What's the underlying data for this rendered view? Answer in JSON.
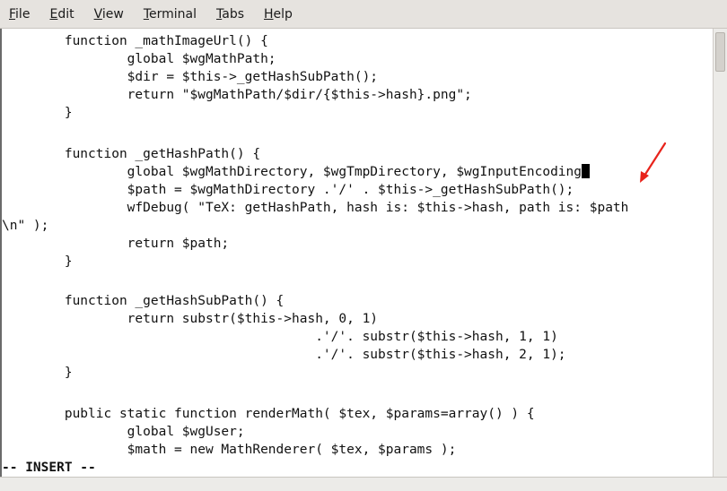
{
  "menu": [
    {
      "mnemonic": "F",
      "rest": "ile"
    },
    {
      "mnemonic": "E",
      "rest": "dit"
    },
    {
      "mnemonic": "V",
      "rest": "iew"
    },
    {
      "mnemonic": "T",
      "rest": "erminal"
    },
    {
      "mnemonic": "T",
      "rest": "abs"
    },
    {
      "mnemonic": "H",
      "rest": "elp"
    }
  ],
  "editor": {
    "lines": [
      "        function _mathImageUrl() {",
      "                global $wgMathPath;",
      "                $dir = $this->_getHashSubPath();",
      "                return \"$wgMathPath/$dir/{$this->hash}.png\";",
      "        }",
      "",
      "        function _getHashPath() {",
      "                global $wgMathDirectory, $wgTmpDirectory, $wgInputEncoding",
      "                $path = $wgMathDirectory .'/' . $this->_getHashSubPath();",
      "                wfDebug( \"TeX: getHashPath, hash is: $this->hash, path is: $path",
      "\\n\" );",
      "                return $path;",
      "        }",
      "",
      "        function _getHashSubPath() {",
      "                return substr($this->hash, 0, 1)",
      "                                        .'/'. substr($this->hash, 1, 1)",
      "                                        .'/'. substr($this->hash, 2, 1);",
      "        }",
      "",
      "        public static function renderMath( $tex, $params=array() ) {",
      "                global $wgUser;",
      "                $math = new MathRenderer( $tex, $params );"
    ],
    "cursor_line": 7,
    "cursor_char": ";",
    "status": "-- INSERT --"
  },
  "annotation": {
    "arrow_color": "#e8231b"
  }
}
